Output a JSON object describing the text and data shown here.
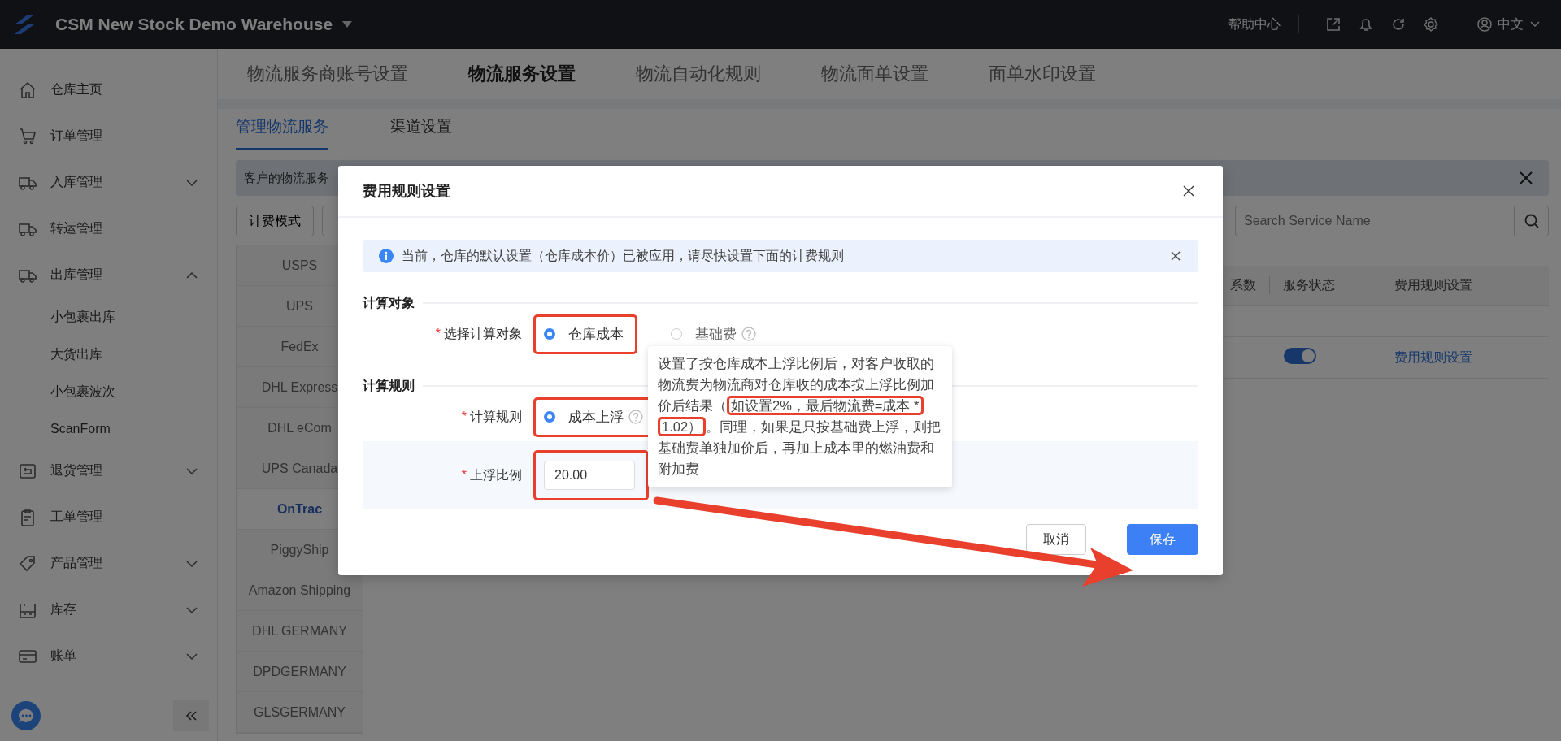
{
  "header": {
    "title": "CSM New Stock Demo Warehouse",
    "help": "帮助中心",
    "language": "中文"
  },
  "sidebar": {
    "items": [
      {
        "label": "仓库主页",
        "kind": "link"
      },
      {
        "label": "订单管理",
        "kind": "link"
      },
      {
        "label": "入库管理",
        "kind": "group",
        "expanded": false
      },
      {
        "label": "转运管理",
        "kind": "link"
      },
      {
        "label": "出库管理",
        "kind": "group",
        "expanded": true,
        "children": [
          {
            "label": "小包裹出库"
          },
          {
            "label": "大货出库"
          },
          {
            "label": "小包裹波次"
          },
          {
            "label": "ScanForm"
          }
        ]
      },
      {
        "label": "退货管理",
        "kind": "group",
        "expanded": false
      },
      {
        "label": "工单管理",
        "kind": "link"
      },
      {
        "label": "产品管理",
        "kind": "group",
        "expanded": false
      },
      {
        "label": "库存",
        "kind": "group",
        "expanded": false
      },
      {
        "label": "账单",
        "kind": "group",
        "expanded": false
      }
    ]
  },
  "top_tabs": [
    {
      "label": "物流服务商账号设置",
      "selected": false
    },
    {
      "label": "物流服务设置",
      "selected": true
    },
    {
      "label": "物流自动化规则",
      "selected": false
    },
    {
      "label": "物流面单设置",
      "selected": false
    },
    {
      "label": "面单水印设置",
      "selected": false
    }
  ],
  "sub_tabs": [
    {
      "label": "管理物流服务",
      "selected": true
    },
    {
      "label": "渠道设置",
      "selected": false
    }
  ],
  "notice": {
    "text": "客户的物流服务"
  },
  "toolbar": {
    "buttons": [
      "计费模式"
    ],
    "search": {
      "placeholder": "Search Service Name"
    }
  },
  "carriers": [
    {
      "label": "USPS",
      "selected": false
    },
    {
      "label": "UPS",
      "selected": false
    },
    {
      "label": "FedEx",
      "selected": false
    },
    {
      "label": "DHL Express",
      "selected": false
    },
    {
      "label": "DHL eCom",
      "selected": false
    },
    {
      "label": "UPS Canada",
      "selected": false
    },
    {
      "label": "OnTrac",
      "selected": true
    },
    {
      "label": "PiggyShip",
      "selected": false
    },
    {
      "label": "Amazon Shipping",
      "selected": false
    },
    {
      "label": "DHL GERMANY",
      "selected": false
    },
    {
      "label": "DPDGERMANY",
      "selected": false
    },
    {
      "label": "GLSGERMANY",
      "selected": false
    }
  ],
  "table": {
    "columns": [
      "系数",
      "服务状态",
      "费用规则设置"
    ],
    "rows": [
      {
        "service_on": true,
        "action": "费用规则设置"
      }
    ]
  },
  "dialog": {
    "title": "费用规则设置",
    "alert": "当前，仓库的默认设置（仓库成本价）已被应用，请尽快设置下面的计费规则",
    "sections": [
      {
        "title": "计算对象",
        "fields": [
          {
            "label": "选择计算对象",
            "required_mark": "*",
            "kind": "radio",
            "options": [
              {
                "label": "仓库成本",
                "selected": true,
                "help": false,
                "annotated": true
              },
              {
                "label": "基础费",
                "selected": false,
                "help": true,
                "annotated": false
              }
            ]
          }
        ]
      },
      {
        "title": "计算规则",
        "fields": [
          {
            "label": "计算规则",
            "required_mark": "*",
            "kind": "radio",
            "options": [
              {
                "label": "成本上浮",
                "selected": true,
                "help": true,
                "annotated": true
              }
            ]
          },
          {
            "label": "上浮比例",
            "required_mark": "*",
            "kind": "input",
            "value": "20.00",
            "annotated": true
          }
        ]
      }
    ],
    "tooltip": [
      {
        "text": "设置了按仓库成本上浮比例后，对客户收取的物流费为物流商对仓库收的成本按上浮比例加价后结果（",
        "annotated": false
      },
      {
        "text": "如设置2%，最后物流费=成本 * 1.02）",
        "annotated": true
      },
      {
        "text": "。同理，如果是只按基础费上浮，则把基础费单独加价后，再加上成本里的燃油费和附加费",
        "annotated": false
      }
    ],
    "buttons": [
      {
        "label": "取消",
        "kind": "secondary"
      },
      {
        "label": "保存",
        "kind": "primary"
      }
    ]
  }
}
